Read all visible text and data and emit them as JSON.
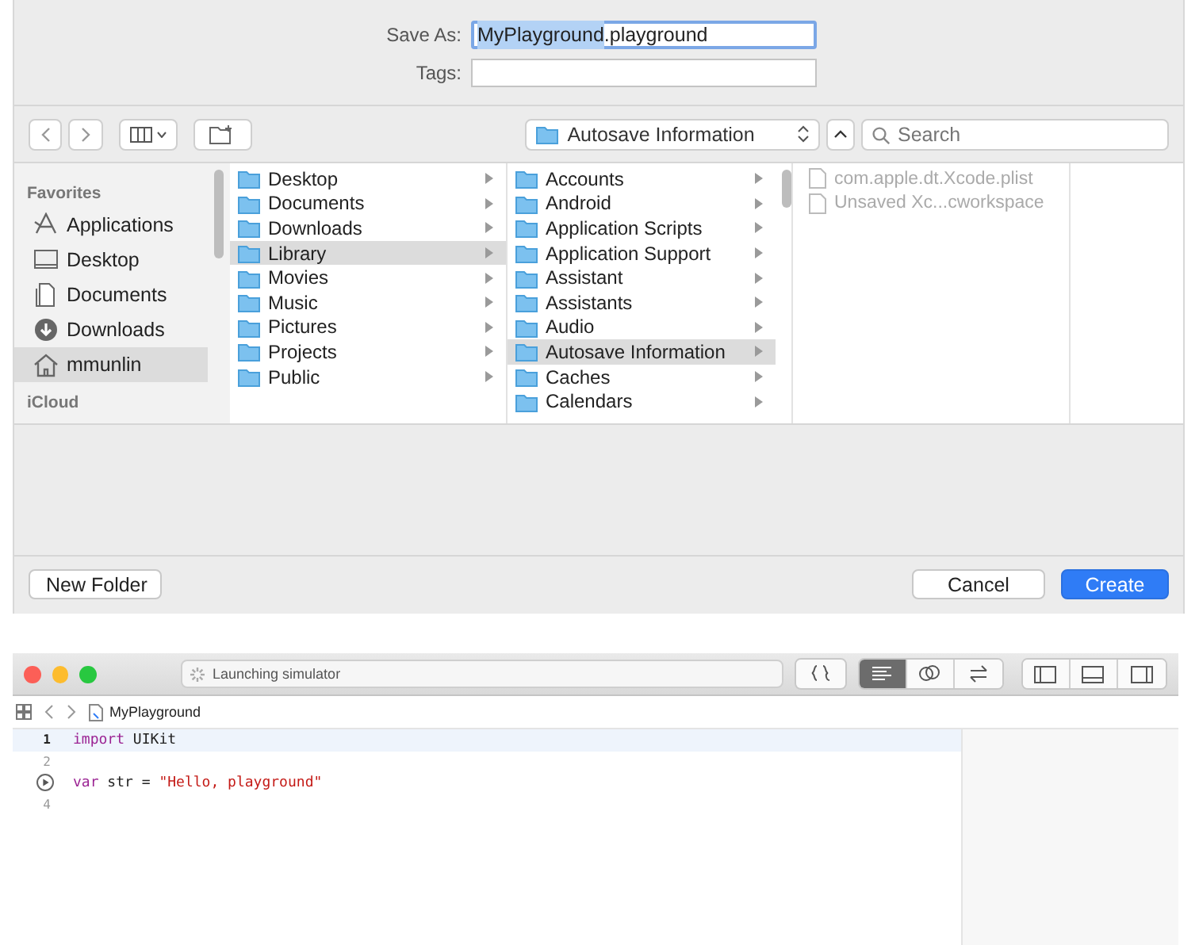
{
  "save_dialog": {
    "save_as": {
      "label": "Save As:",
      "selected_text": "MyPlayground",
      "rest_text": ".playground"
    },
    "tags": {
      "label": "Tags:"
    },
    "toolbar": {
      "location": "Autosave Information",
      "search": {
        "placeholder": "Search"
      }
    },
    "sidebar": {
      "sections": [
        {
          "title": "Favorites",
          "items": [
            {
              "label": "Applications",
              "selected": false
            },
            {
              "label": "Desktop",
              "selected": false
            },
            {
              "label": "Documents",
              "selected": false
            },
            {
              "label": "Downloads",
              "selected": false
            },
            {
              "label": "mmunlin",
              "selected": true
            }
          ]
        },
        {
          "title": "iCloud"
        }
      ]
    },
    "columns": [
      {
        "items": [
          {
            "label": "Desktop",
            "selected": false
          },
          {
            "label": "Documents",
            "selected": false
          },
          {
            "label": "Downloads",
            "selected": false
          },
          {
            "label": "Library",
            "selected": true
          },
          {
            "label": "Movies",
            "selected": false
          },
          {
            "label": "Music",
            "selected": false
          },
          {
            "label": "Pictures",
            "selected": false
          },
          {
            "label": "Projects",
            "selected": false
          },
          {
            "label": "Public",
            "selected": false
          }
        ]
      },
      {
        "items": [
          {
            "label": "Accounts",
            "selected": false
          },
          {
            "label": "Android",
            "selected": false
          },
          {
            "label": "Application Scripts",
            "selected": false
          },
          {
            "label": "Application Support",
            "selected": false
          },
          {
            "label": "Assistant",
            "selected": false
          },
          {
            "label": "Assistants",
            "selected": false
          },
          {
            "label": "Audio",
            "selected": false
          },
          {
            "label": "Autosave Information",
            "selected": true
          },
          {
            "label": "Caches",
            "selected": false
          },
          {
            "label": "Calendars",
            "selected": false
          }
        ]
      },
      {
        "files": [
          {
            "label": "com.apple.dt.Xcode.plist",
            "disabled": true
          },
          {
            "label": "Unsaved Xc...cworkspace",
            "disabled": true
          }
        ]
      }
    ],
    "buttons": [
      {
        "label": "New Folder",
        "kind": "plain"
      },
      {
        "label": "Cancel",
        "kind": "plain"
      },
      {
        "label": "Create",
        "kind": "default"
      }
    ]
  },
  "xcode": {
    "status": "Launching simulator",
    "toolbar_buttons": [
      {
        "selected": false
      },
      {
        "selected": true
      },
      {
        "selected": false
      },
      {
        "selected": false
      }
    ],
    "breadcrumb": "MyPlayground",
    "lines": [
      {
        "kind": "number",
        "number": "1",
        "current": true,
        "tokens": [
          {
            "kind": "keyword",
            "text": "import"
          },
          {
            "kind": "plain",
            "text": " UIKit"
          }
        ]
      },
      {
        "kind": "number",
        "number": "2",
        "current": false
      },
      {
        "kind": "run",
        "current": false,
        "tokens": [
          {
            "kind": "keyword",
            "text": "var"
          },
          {
            "kind": "plain",
            "text": " str = "
          },
          {
            "kind": "string",
            "text": "\"Hello, playground\""
          }
        ]
      },
      {
        "kind": "number",
        "number": "4",
        "current": false
      }
    ]
  }
}
